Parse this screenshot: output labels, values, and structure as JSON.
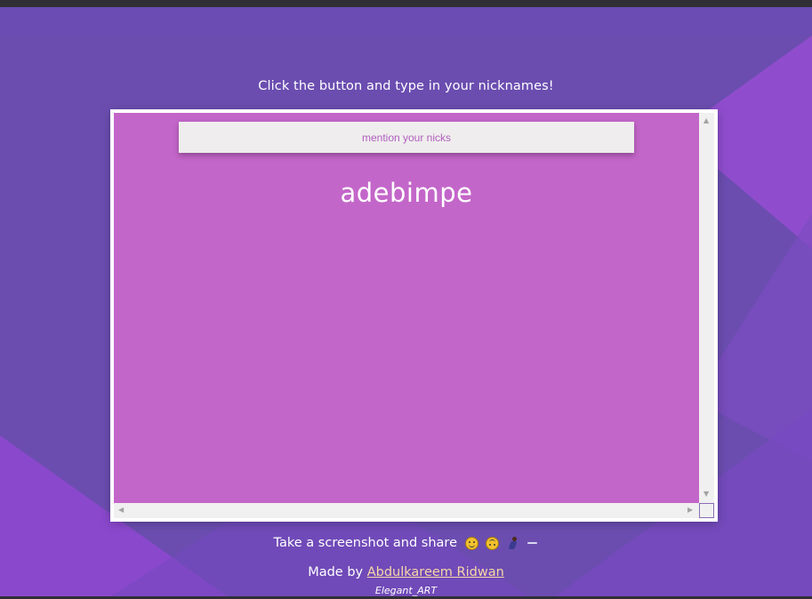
{
  "theme": {
    "background": "#6b4db0",
    "panel": "#c366c9",
    "button_bg": "#efeded",
    "button_text": "#b05fbf",
    "link": "#f7d8a7"
  },
  "header": {
    "instruction": "Click the button and type in your nicknames!"
  },
  "panel": {
    "button_label": "mention your nicks",
    "nickname": "adebimpe"
  },
  "footer": {
    "share_text": "Take a screenshot and share",
    "share_emojis": [
      "smirk-face-icon",
      "upside-down-face-icon",
      "running-person-icon",
      "dash-icon"
    ],
    "made_by_prefix": "Made by",
    "author": "Abdulkareem Ridwan",
    "signature": "Elegant_ART"
  }
}
